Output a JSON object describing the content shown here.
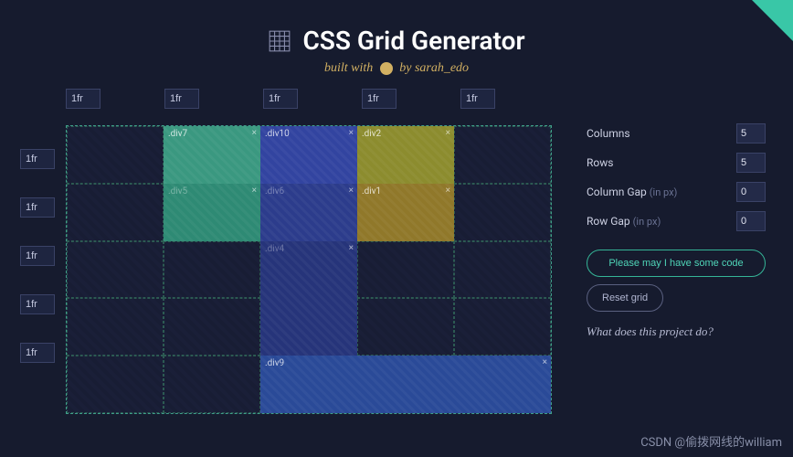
{
  "header": {
    "title": "CSS Grid Generator",
    "subtitle_prefix": "built with ",
    "subtitle_suffix": " by sarah_edo"
  },
  "column_units": [
    "1fr",
    "1fr",
    "1fr",
    "1fr",
    "1fr"
  ],
  "row_units": [
    "1fr",
    "1fr",
    "1fr",
    "1fr",
    "1fr"
  ],
  "placed_divs": {
    "d7": ".div7",
    "d10": ".div10",
    "d2": ".div2",
    "d5": ".div5",
    "d6": ".div6",
    "d1": ".div1",
    "d4": ".div4",
    "d9": ".div9"
  },
  "close_glyph": "×",
  "sidebar": {
    "labels": {
      "columns": "Columns",
      "rows": "Rows",
      "col_gap": "Column Gap",
      "row_gap": "Row Gap",
      "px_hint": "(in px)"
    },
    "values": {
      "columns": "5",
      "rows": "5",
      "col_gap": "0",
      "row_gap": "0"
    },
    "code_btn": "Please may I have some code",
    "reset_btn": "Reset grid",
    "project_link": "What does this project do?"
  },
  "watermark": "CSDN @偷拨网线的william"
}
